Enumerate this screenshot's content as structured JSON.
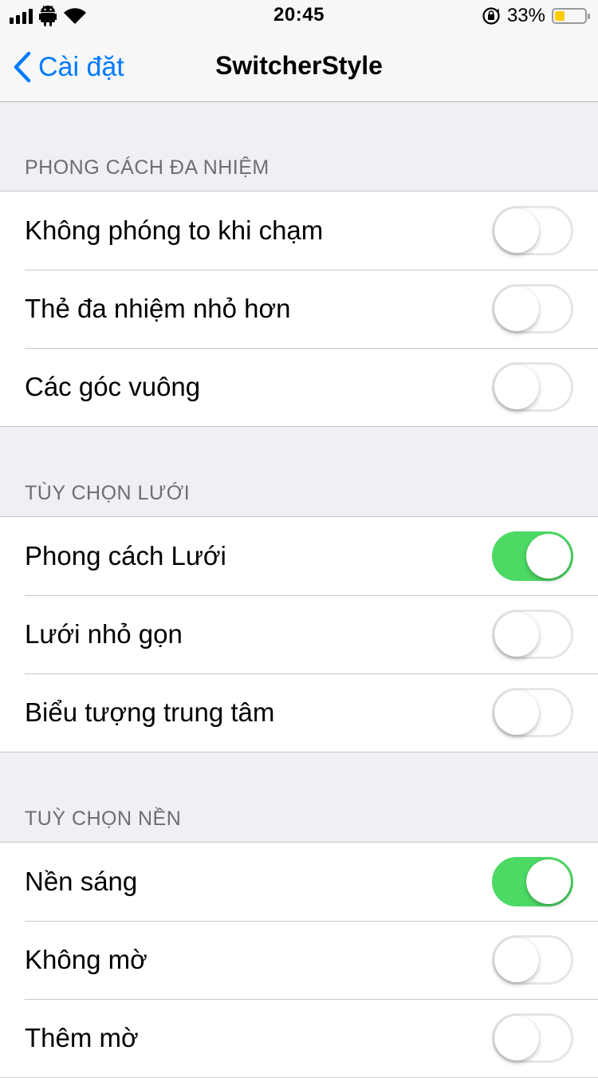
{
  "status_bar": {
    "time": "20:45",
    "battery_percent": "33%",
    "battery_level": 0.33,
    "icons": [
      "signal-bars-icon",
      "android-icon",
      "wifi-icon",
      "rotation-lock-icon",
      "battery-icon"
    ]
  },
  "nav": {
    "back_label": "Cài đặt",
    "title": "SwitcherStyle"
  },
  "sections": [
    {
      "header": "PHONG CÁCH ĐA NHIỆM",
      "rows": [
        {
          "label": "Không phóng to khi chạm",
          "on": false
        },
        {
          "label": "Thẻ đa nhiệm nhỏ hơn",
          "on": false
        },
        {
          "label": "Các góc vuông",
          "on": false
        }
      ]
    },
    {
      "header": "TÙY CHỌN LƯỚI",
      "rows": [
        {
          "label": "Phong cách Lưới",
          "on": true
        },
        {
          "label": "Lưới nhỏ gọn",
          "on": false
        },
        {
          "label": "Biểu tượng trung tâm",
          "on": false
        }
      ]
    },
    {
      "header": "TUỲ CHỌN NỀN",
      "rows": [
        {
          "label": "Nền sáng",
          "on": true
        },
        {
          "label": "Không mờ",
          "on": false
        },
        {
          "label": "Thêm mờ",
          "on": false
        }
      ]
    }
  ],
  "colors": {
    "accent": "#007aff",
    "toggle_on": "#4cd964",
    "background": "#efeff4",
    "battery": "#ffcc00"
  }
}
